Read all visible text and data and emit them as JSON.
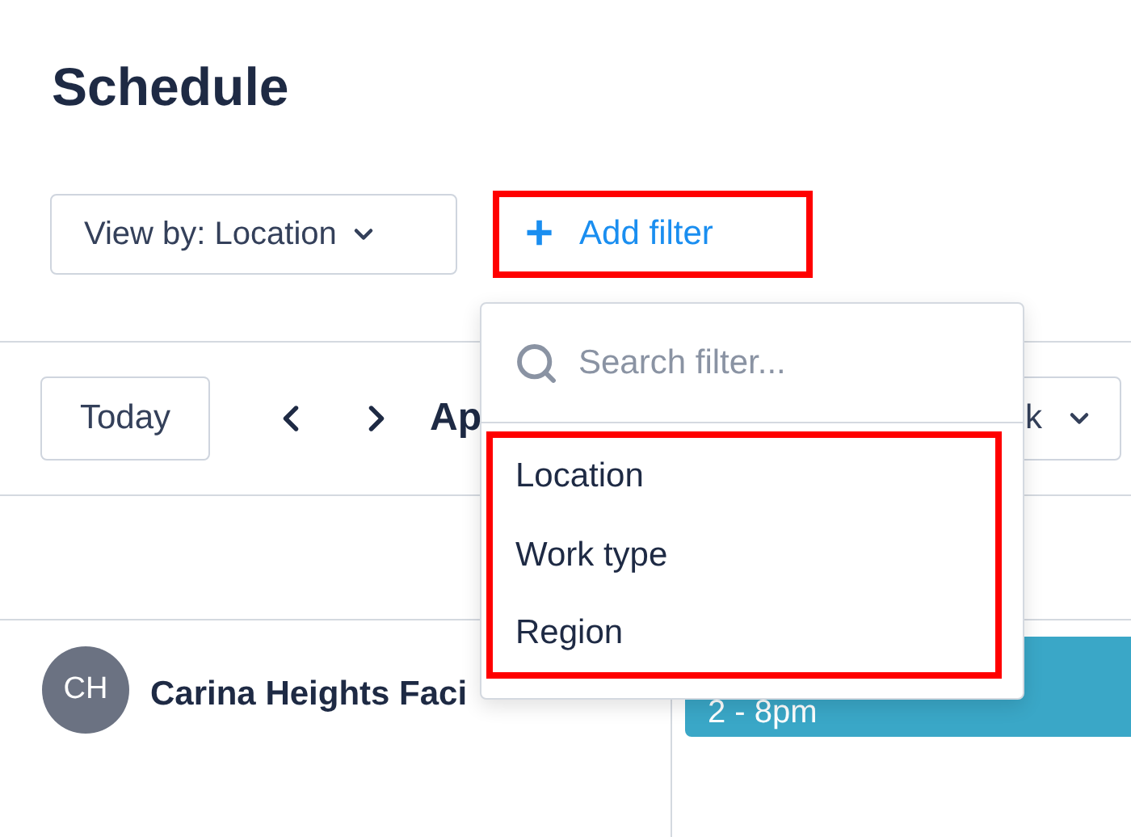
{
  "title": "Schedule",
  "view_by": {
    "label": "View by: Location"
  },
  "add_filter": {
    "icon": "+",
    "label": "Add filter",
    "highlighted": true
  },
  "toolbar": {
    "today": "Today",
    "date_label": "Ap",
    "range_label": "k"
  },
  "rows": [
    {
      "initials": "CH",
      "name": "Carina Heights Faci",
      "event": "2 - 8pm",
      "color": "#3aa7c7"
    }
  ],
  "filter_menu": {
    "search": {
      "placeholder": "Search filter..."
    },
    "options_highlighted": true,
    "options": [
      {
        "label": "Location"
      },
      {
        "label": "Work type"
      },
      {
        "label": "Region"
      }
    ]
  }
}
